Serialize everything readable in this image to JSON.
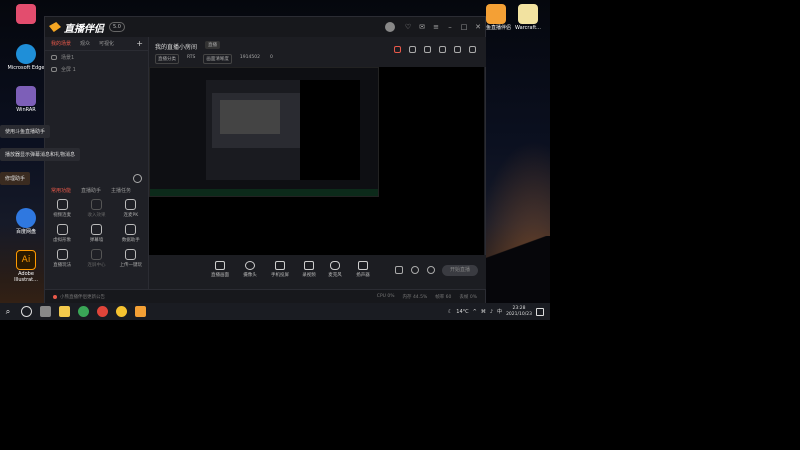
{
  "desktop": {
    "icons": [
      {
        "label": "",
        "color": "#e34d6e"
      },
      {
        "label": "Microsoft Edge",
        "color": "#1f8fd8"
      },
      {
        "label": "WinRAR",
        "color": "#7d5fb8"
      },
      {
        "label": "百度网盘",
        "color": "#2f78e0"
      },
      {
        "label": "Adobe Illustrat...",
        "color": "#ff9a00"
      },
      {
        "label": "斗鱼直播伴侣",
        "color": "#f4a035"
      },
      {
        "label": "Warcraft...",
        "color": "#f2e2a0"
      }
    ]
  },
  "toasts": [
    "使用斗鱼直播助手",
    "播放器显示弹幕消息和礼物消息",
    "修理助手"
  ],
  "app": {
    "name": "直播伴侣",
    "version": "5.0",
    "left_tabs": [
      {
        "label": "我的场景",
        "active": true
      },
      {
        "label": "观众",
        "active": false
      },
      {
        "label": "可视化",
        "active": false
      }
    ],
    "plus": "+",
    "scenes": [
      {
        "label": "场景1"
      },
      {
        "label": "全屏 1"
      }
    ],
    "tool_tabs": [
      {
        "label": "常用功能",
        "active": true
      },
      {
        "label": "直播助手",
        "active": false
      },
      {
        "label": "主播任务",
        "active": false
      }
    ],
    "tools": [
      {
        "label": "视频连麦",
        "dim": false
      },
      {
        "label": "收入效果",
        "dim": true
      },
      {
        "label": "连麦PK",
        "dim": false
      },
      {
        "label": "虚拟形象",
        "dim": false
      },
      {
        "label": "弹幕墙",
        "dim": false
      },
      {
        "label": "数据助手",
        "dim": false
      },
      {
        "label": "直播玩法",
        "dim": false
      },
      {
        "label": "连屏中心",
        "dim": true
      },
      {
        "label": "上传一键玩",
        "dim": false
      }
    ],
    "room": {
      "title": "我的直播小房间",
      "tag": "直播",
      "meta": [
        "直播分类",
        "RTS",
        "画面清晰度",
        "1914502",
        "0"
      ]
    },
    "controls": [
      {
        "label": "直播画面"
      },
      {
        "label": "摄像头"
      },
      {
        "label": "手机投屏"
      },
      {
        "label": "录视频"
      },
      {
        "label": "麦克风"
      },
      {
        "label": "扬声器"
      }
    ],
    "start_button": "开始直播",
    "status": {
      "announcement": "小熊直播伴侣更新公告",
      "stats": [
        "CPU 0%",
        "内存 44.5%",
        "帧率 60",
        "丢帧 0%"
      ]
    }
  },
  "taskbar": {
    "weather": "14°C",
    "time": "23:28",
    "date": "2021/10/23"
  }
}
